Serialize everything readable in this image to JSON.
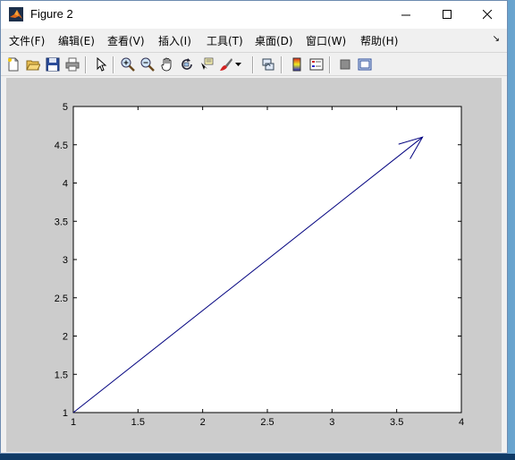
{
  "window": {
    "title": "Figure 2"
  },
  "menu": {
    "items": [
      "文件(F)",
      "编辑(E)",
      "查看(V)",
      "插入(I)",
      "工具(T)",
      "桌面(D)",
      "窗口(W)",
      "帮助(H)"
    ]
  },
  "toolbar": {
    "icons": [
      "new-figure-icon",
      "open-file-icon",
      "save-icon",
      "print-icon",
      "edit-plot-arrow-icon",
      "zoom-in-icon",
      "zoom-out-icon",
      "pan-hand-icon",
      "rotate-3d-icon",
      "data-cursor-icon",
      "brush-icon",
      "brush-dropdown-icon",
      "link-plot-icon",
      "colorbar-icon",
      "legend-icon",
      "hide-plot-tools-icon",
      "show-plot-tools-icon"
    ]
  },
  "colors": {
    "line": "#00007f",
    "figure_bg": "#cccccc",
    "axes_bg": "#ffffff"
  },
  "chart_data": {
    "type": "line",
    "series": [
      {
        "x": [
          1,
          3.7
        ],
        "y": [
          1,
          4.6
        ],
        "arrowhead": true
      }
    ],
    "xlim": [
      1,
      4
    ],
    "ylim": [
      1,
      5
    ],
    "xticks": [
      1,
      1.5,
      2,
      2.5,
      3,
      3.5,
      4
    ],
    "yticks": [
      1,
      1.5,
      2,
      2.5,
      3,
      3.5,
      4,
      4.5,
      5
    ],
    "xtick_labels": [
      "1",
      "1.5",
      "2",
      "2.5",
      "3",
      "3.5",
      "4"
    ],
    "ytick_labels": [
      "1",
      "1.5",
      "2",
      "2.5",
      "3",
      "3.5",
      "4",
      "4.5",
      "5"
    ]
  }
}
